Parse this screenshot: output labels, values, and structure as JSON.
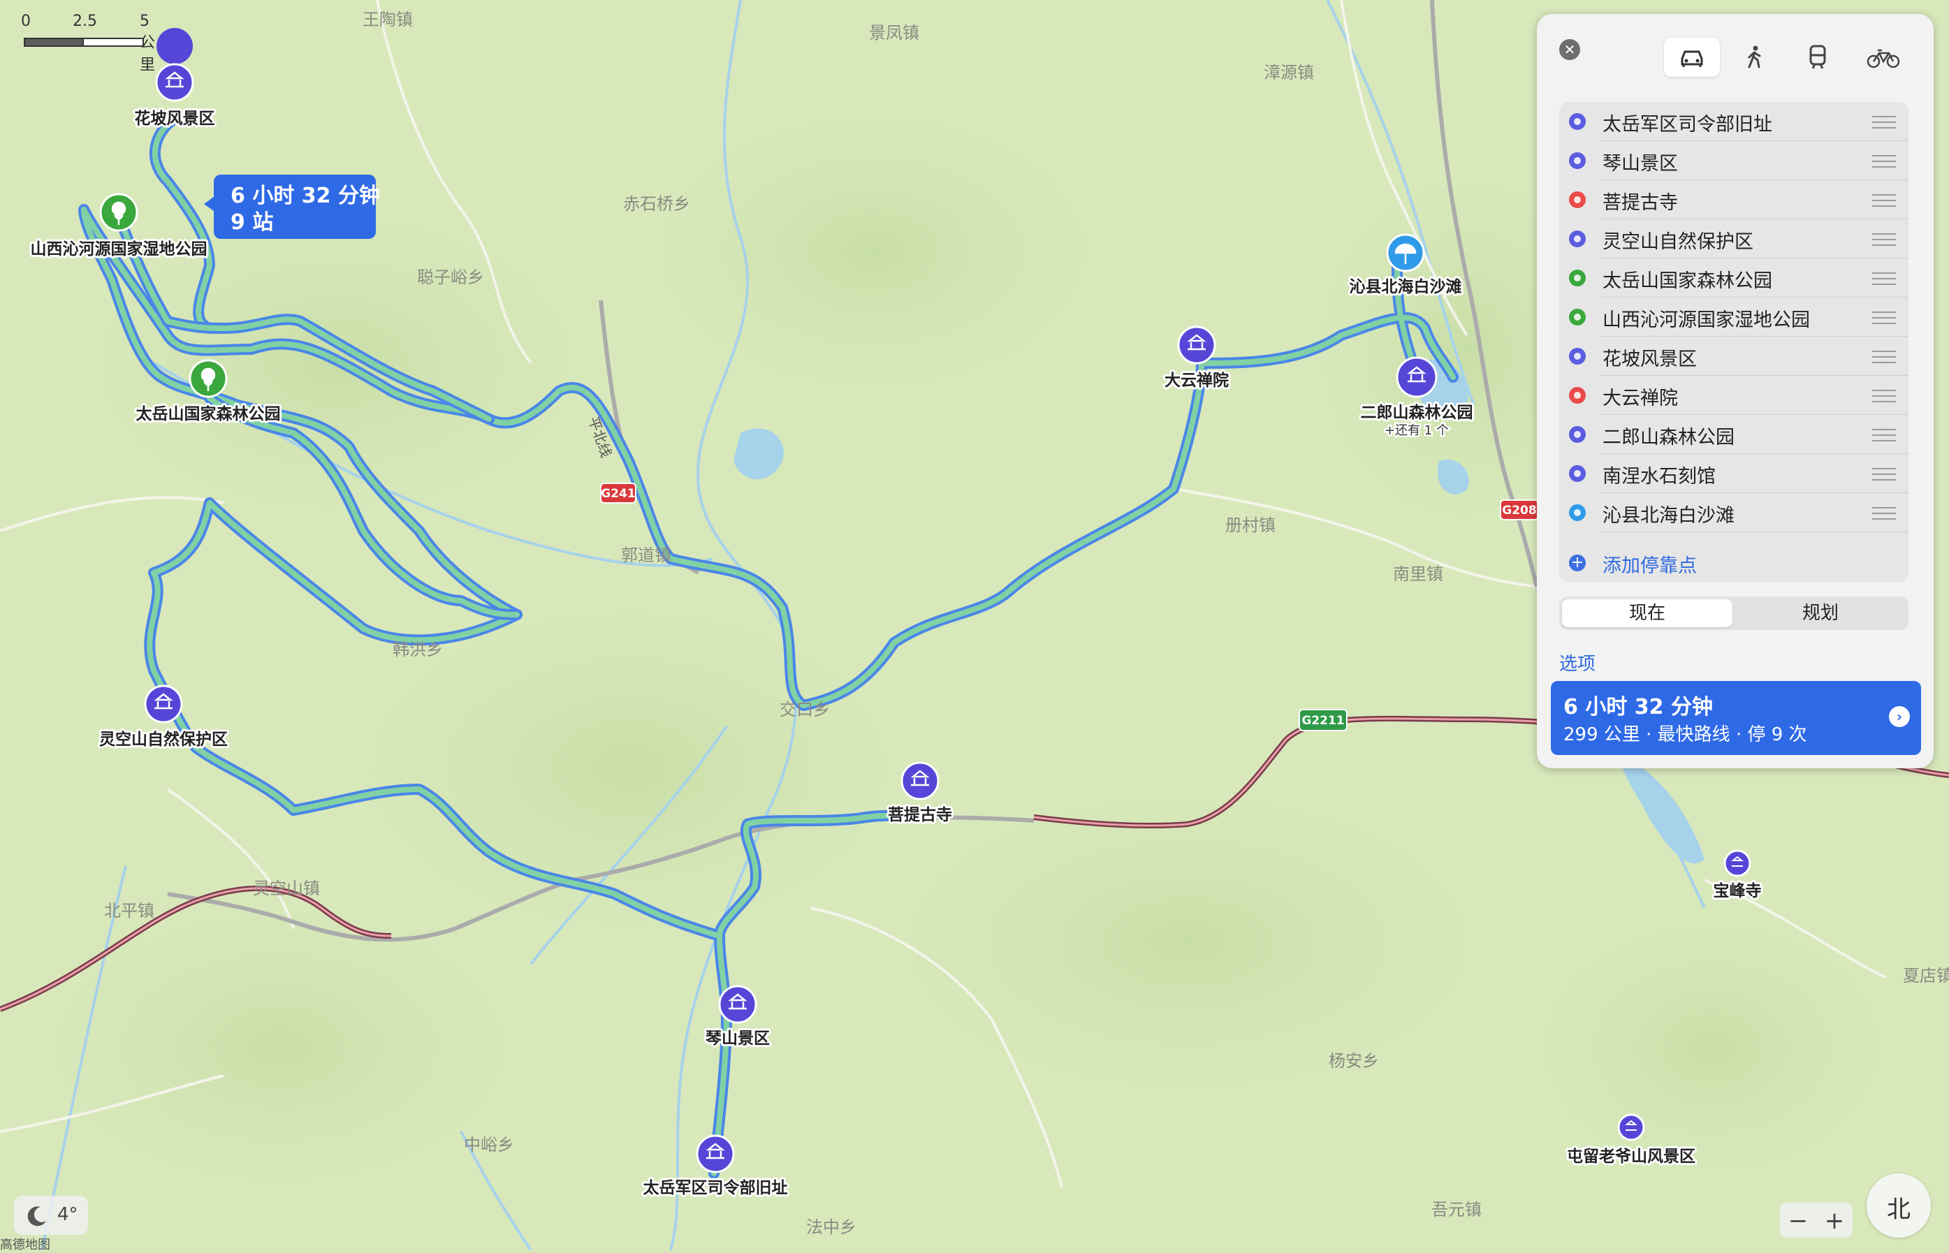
{
  "scale": {
    "labels": [
      "0",
      "2.5",
      "5 公里"
    ]
  },
  "map": {
    "places": [
      "王陶镇",
      "景凤镇",
      "漳源镇",
      "赤石桥乡",
      "聪子峪乡",
      "郭道镇",
      "册村镇",
      "南里镇",
      "韩洪乡",
      "交口乡",
      "灵空山镇",
      "北平镇",
      "中峪乡",
      "杨安乡",
      "吾元镇",
      "法中乡",
      "夏店镇"
    ],
    "road_labels": [
      "G241",
      "G208",
      "G2211",
      "平北线"
    ],
    "pois": [
      {
        "name": "花坡风景区"
      },
      {
        "name": "山西沁河源国家湿地公园"
      },
      {
        "name": "太岳山国家森林公园"
      },
      {
        "name": "灵空山自然保护区"
      },
      {
        "name": "菩提古寺"
      },
      {
        "name": "琴山景区"
      },
      {
        "name": "太岳军区司令部旧址"
      },
      {
        "name": "大云禅院"
      },
      {
        "name": "沁县北海白沙滩"
      },
      {
        "name": "二郎山森林公园",
        "sub": "+还有 1 个"
      },
      {
        "name": "宝峰寺"
      },
      {
        "name": "屯留老爷山风景区"
      }
    ],
    "callout": {
      "time": "6 小时 32 分钟",
      "stops": "9 站"
    },
    "colors": {
      "route": "#4a86e8",
      "route_fill": "#7dcfa0",
      "temple_pin": "#4b3ad6",
      "park_pin": "#3aa83c",
      "beach_pin": "#2f9be8"
    }
  },
  "panel": {
    "close_icon": "close-icon",
    "modes": [
      "car-icon",
      "walk-icon",
      "transit-icon",
      "bike-icon"
    ],
    "stops": [
      {
        "name": "太岳军区司令部旧址",
        "color": "#5b5ce0"
      },
      {
        "name": "琴山景区",
        "color": "#5b5ce0"
      },
      {
        "name": "菩提古寺",
        "color": "#ea4a4a"
      },
      {
        "name": "灵空山自然保护区",
        "color": "#5b5ce0"
      },
      {
        "name": "太岳山国家森林公园",
        "color": "#3aa83c"
      },
      {
        "name": "山西沁河源国家湿地公园",
        "color": "#3aa83c"
      },
      {
        "name": "花坡风景区",
        "color": "#5b5ce0"
      },
      {
        "name": "大云禅院",
        "color": "#ea4a4a"
      },
      {
        "name": "二郎山森林公园",
        "color": "#5b5ce0"
      },
      {
        "name": "南涅水石刻馆",
        "color": "#5b5ce0"
      },
      {
        "name": "沁县北海白沙滩",
        "color": "#2f9be8"
      }
    ],
    "add_stop": "添加停靠点",
    "time_options": [
      "现在",
      "规划"
    ],
    "options_link": "选项",
    "route": {
      "time": "6 小时 32 分钟",
      "detail": "299 公里 · 最快路线 · 停 9 次"
    }
  },
  "weather": {
    "temp": "4°",
    "icon": "moon-icon"
  },
  "legal": "高德地图",
  "zoom": {
    "minus": "−",
    "plus": "+"
  },
  "compass": {
    "label": "北"
  }
}
